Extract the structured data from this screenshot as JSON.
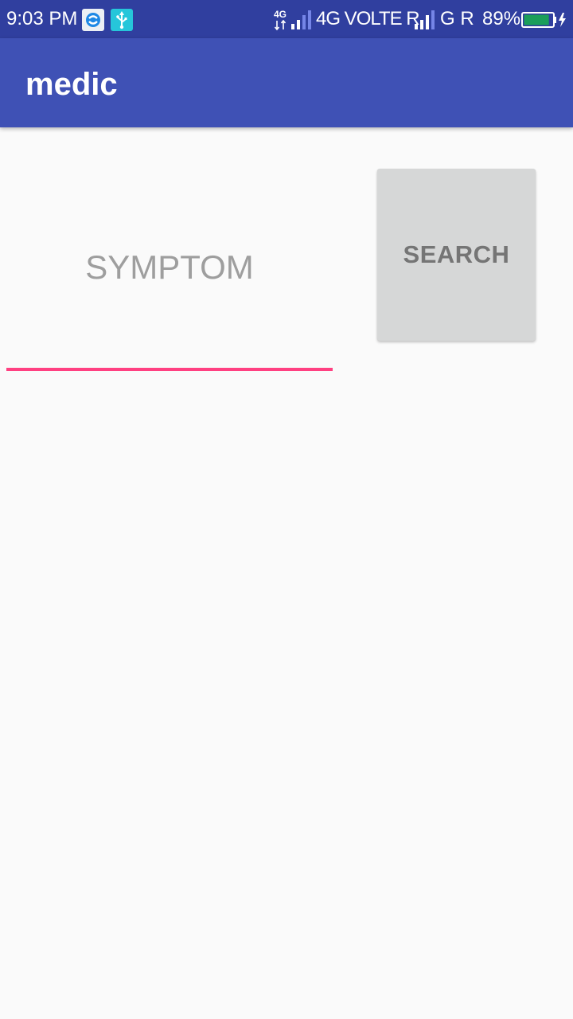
{
  "status_bar": {
    "time": "9:03 PM",
    "net_type_small": "4G",
    "sim1_network": "4G VOLTE R",
    "sim2_network": "G R",
    "battery_percent": "89%",
    "battery_level": 0.89,
    "icons": {
      "app1": "sync-icon",
      "app2": "usb-icon",
      "signal": "signal-strength-icon",
      "battery": "battery-charging-icon"
    },
    "colors": {
      "background": "#303f9f",
      "battery_fill": "#1b9e5a"
    }
  },
  "app_bar": {
    "title": "medic",
    "color": "#3f51b5"
  },
  "main": {
    "symptom_placeholder": "SYMPTOM",
    "symptom_value": "",
    "search_label": "SEARCH",
    "accent_color": "#ff4081"
  }
}
